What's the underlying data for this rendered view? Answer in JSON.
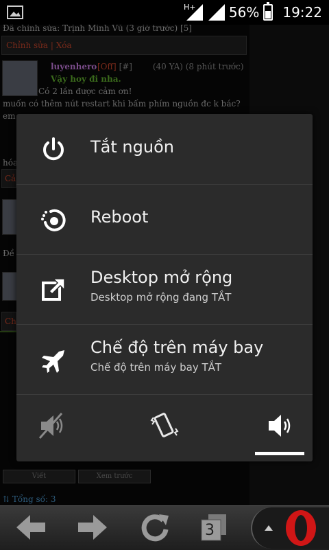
{
  "status_bar": {
    "network_type": "H+",
    "battery_percent": "56%",
    "battery_level": 0.56,
    "time": "19:22"
  },
  "background_page": {
    "edited_line": "Đã chỉnh sửa: Trịnh Minh Vũ (3 giờ trước) [5]",
    "edit_link": "Chỉnh sửa",
    "delete_link": "Xóa",
    "post_username": "luyenhero",
    "post_status": "[Off]",
    "post_hash": "[#]",
    "post_meta": "(40 YA) (8 phút trước)",
    "post_quote": "Vậy hoy đi nha.",
    "thanks_line": "Có 2 lần được cảm ơn!",
    "post_text_1": "muốn có thêm nút restart khi bấm phím nguồn đc k bác?",
    "post_text_2": "em",
    "post_text_3": "hóa",
    "fragment_1": "Cả",
    "fragment_2": "Đề",
    "fragment_3": "Chi",
    "write_button": "Viết",
    "preview_button": "Xem trước",
    "total_label": "Tổng số: 3"
  },
  "power_menu": {
    "items": [
      {
        "title": "Tắt nguồn",
        "subtitle": "",
        "icon": "power-icon"
      },
      {
        "title": "Reboot",
        "subtitle": "",
        "icon": "reboot-icon"
      },
      {
        "title": "Desktop mở rộng",
        "subtitle": "Desktop mở rộng đang TẮT",
        "icon": "expand-desktop-icon"
      },
      {
        "title": "Chế độ trên máy bay",
        "subtitle": "Chế độ trên máy bay TẮT",
        "icon": "airplane-icon"
      }
    ],
    "sound_modes": [
      "silent",
      "vibrate",
      "sound-on"
    ],
    "selected_sound_mode": "sound-on"
  },
  "nav_bar": {
    "tab_count": "3"
  }
}
